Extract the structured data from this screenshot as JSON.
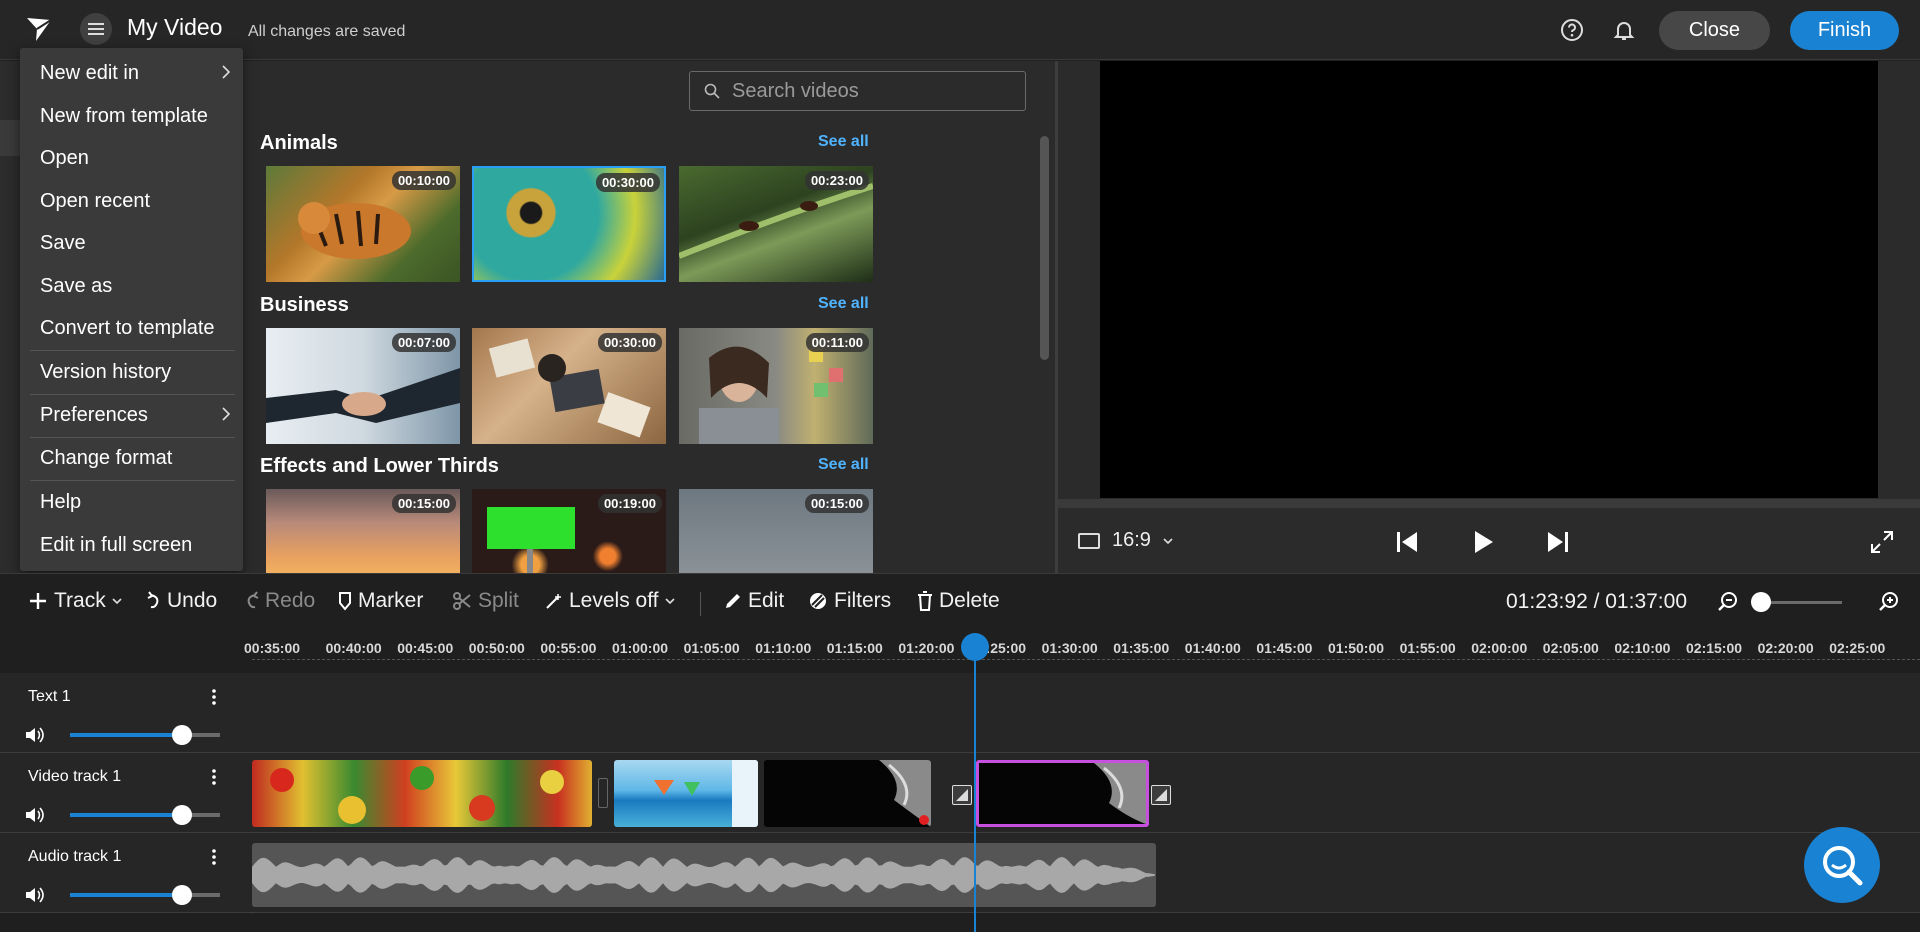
{
  "header": {
    "title": "My Video",
    "save_status": "All changes are saved",
    "close_label": "Close",
    "finish_label": "Finish"
  },
  "file_menu": {
    "items": [
      {
        "label": "New edit in",
        "submenu": true
      },
      {
        "label": "New from template"
      },
      {
        "label": "Open"
      },
      {
        "label": "Open recent"
      },
      {
        "label": "Save"
      },
      {
        "label": "Save as"
      },
      {
        "label": "Convert to template"
      },
      {
        "label": "Version history"
      },
      {
        "label": "Preferences",
        "submenu": true
      },
      {
        "label": "Change format"
      },
      {
        "label": "Help"
      },
      {
        "label": "Edit in full screen"
      }
    ]
  },
  "library": {
    "search_placeholder": "Search videos",
    "see_all_label": "See all",
    "sections": [
      {
        "title": "Animals",
        "items": [
          {
            "subject": "tiger",
            "duration": "00:10:00"
          },
          {
            "subject": "chameleon eye",
            "duration": "00:30:00",
            "selected": true
          },
          {
            "subject": "ants on grass",
            "duration": "00:23:00"
          }
        ]
      },
      {
        "title": "Business",
        "items": [
          {
            "subject": "handshake",
            "duration": "00:07:00"
          },
          {
            "subject": "laptop desk",
            "duration": "00:30:00"
          },
          {
            "subject": "woman with sticky notes",
            "duration": "00:11:00"
          }
        ]
      },
      {
        "title": "Effects and Lower Thirds",
        "items": [
          {
            "subject": "light leak",
            "duration": "00:15:00"
          },
          {
            "subject": "green screen billboard",
            "duration": "00:19:00"
          },
          {
            "subject": "grey texture",
            "duration": "00:15:00"
          }
        ]
      }
    ]
  },
  "preview": {
    "aspect_ratio": "16:9"
  },
  "toolbar": {
    "track": "Track",
    "undo": "Undo",
    "redo": "Redo",
    "marker": "Marker",
    "split": "Split",
    "levels": "Levels off",
    "edit": "Edit",
    "filters": "Filters",
    "delete": "Delete",
    "timecode": "01:23:92 / 01:37:00"
  },
  "ruler": {
    "ticks": [
      "00:35:00",
      "00:40:00",
      "00:45:00",
      "00:50:00",
      "00:55:00",
      "01:00:00",
      "01:05:00",
      "01:10:00",
      "01:15:00",
      "01:20:00",
      "01:25:00",
      "01:30:00",
      "01:35:00",
      "01:40:00",
      "01:45:00",
      "01:50:00",
      "01:55:00",
      "02:00:00",
      "02:05:00",
      "02:10:00",
      "02:15:00",
      "02:20:00",
      "02:25:00"
    ]
  },
  "tracks": [
    {
      "name": "Text 1",
      "volume": 0.75
    },
    {
      "name": "Video track 1",
      "volume": 0.75
    },
    {
      "name": "Audio track 1",
      "volume": 0.75
    }
  ],
  "colors": {
    "accent": "#1a82d2",
    "link": "#4fb3ff",
    "selected_clip": "#c84fe0"
  }
}
